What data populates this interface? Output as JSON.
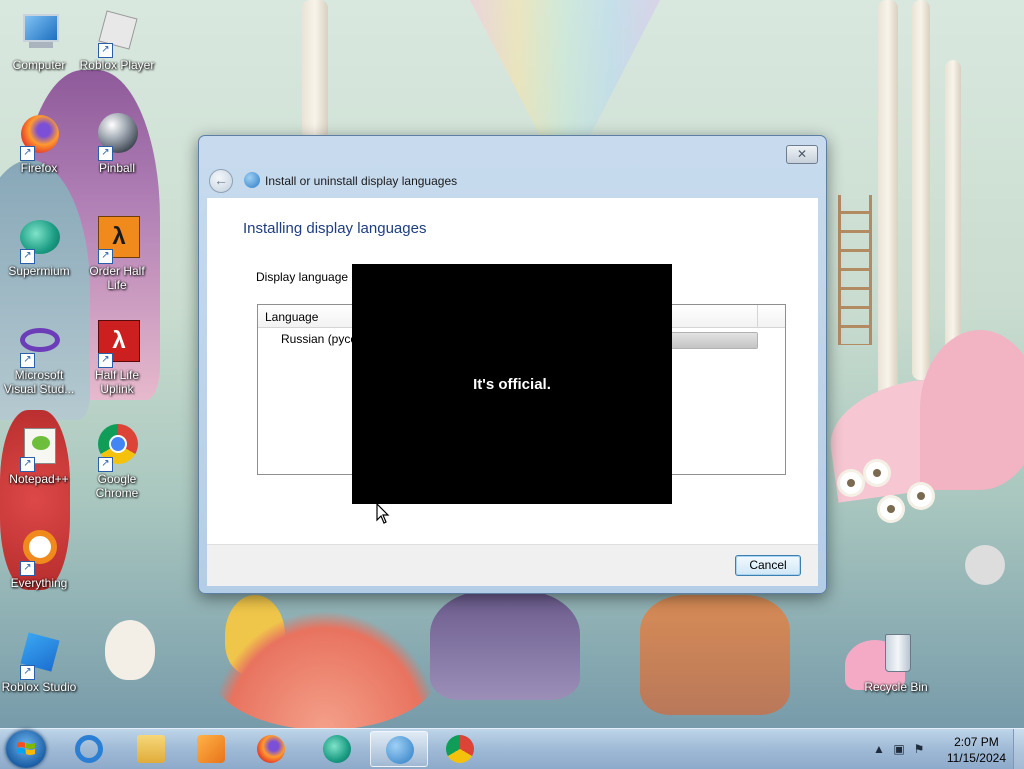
{
  "desktop": {
    "icons": [
      {
        "label": "Computer"
      },
      {
        "label": "Roblox Player"
      },
      {
        "label": "Firefox"
      },
      {
        "label": "Pinball"
      },
      {
        "label": "Supermium"
      },
      {
        "label": "Order Half Life"
      },
      {
        "label": "Microsoft Visual Stud..."
      },
      {
        "label": "Half Life Uplink"
      },
      {
        "label": "Notepad++"
      },
      {
        "label": "Google Chrome"
      },
      {
        "label": "Everything"
      },
      {
        "label": "Roblox Studio"
      },
      {
        "label": "Recycle Bin"
      }
    ]
  },
  "dialog": {
    "close_glyph": "✕",
    "back_glyph": "←",
    "title": "Install or uninstall display languages",
    "heading": "Installing display languages",
    "label": "Display language i",
    "list": {
      "column_header": "Language",
      "rows": [
        {
          "language": "Russian (pycc",
          "progress": 1.0
        }
      ]
    },
    "cancel_label": "Cancel"
  },
  "overlay": {
    "message": "It's official."
  },
  "taskbar": {
    "pinned": [
      "ie-icon",
      "explorer-icon",
      "media-player-icon",
      "firefox-icon",
      "supermium-icon",
      "language-setup-icon",
      "chrome-icon"
    ],
    "clock": {
      "time": "2:07 PM",
      "date": "11/15/2024"
    }
  },
  "colors": {
    "dialog_heading": "#1e3e80",
    "taskbar": "#9fbad6",
    "overlay": "#000000"
  }
}
